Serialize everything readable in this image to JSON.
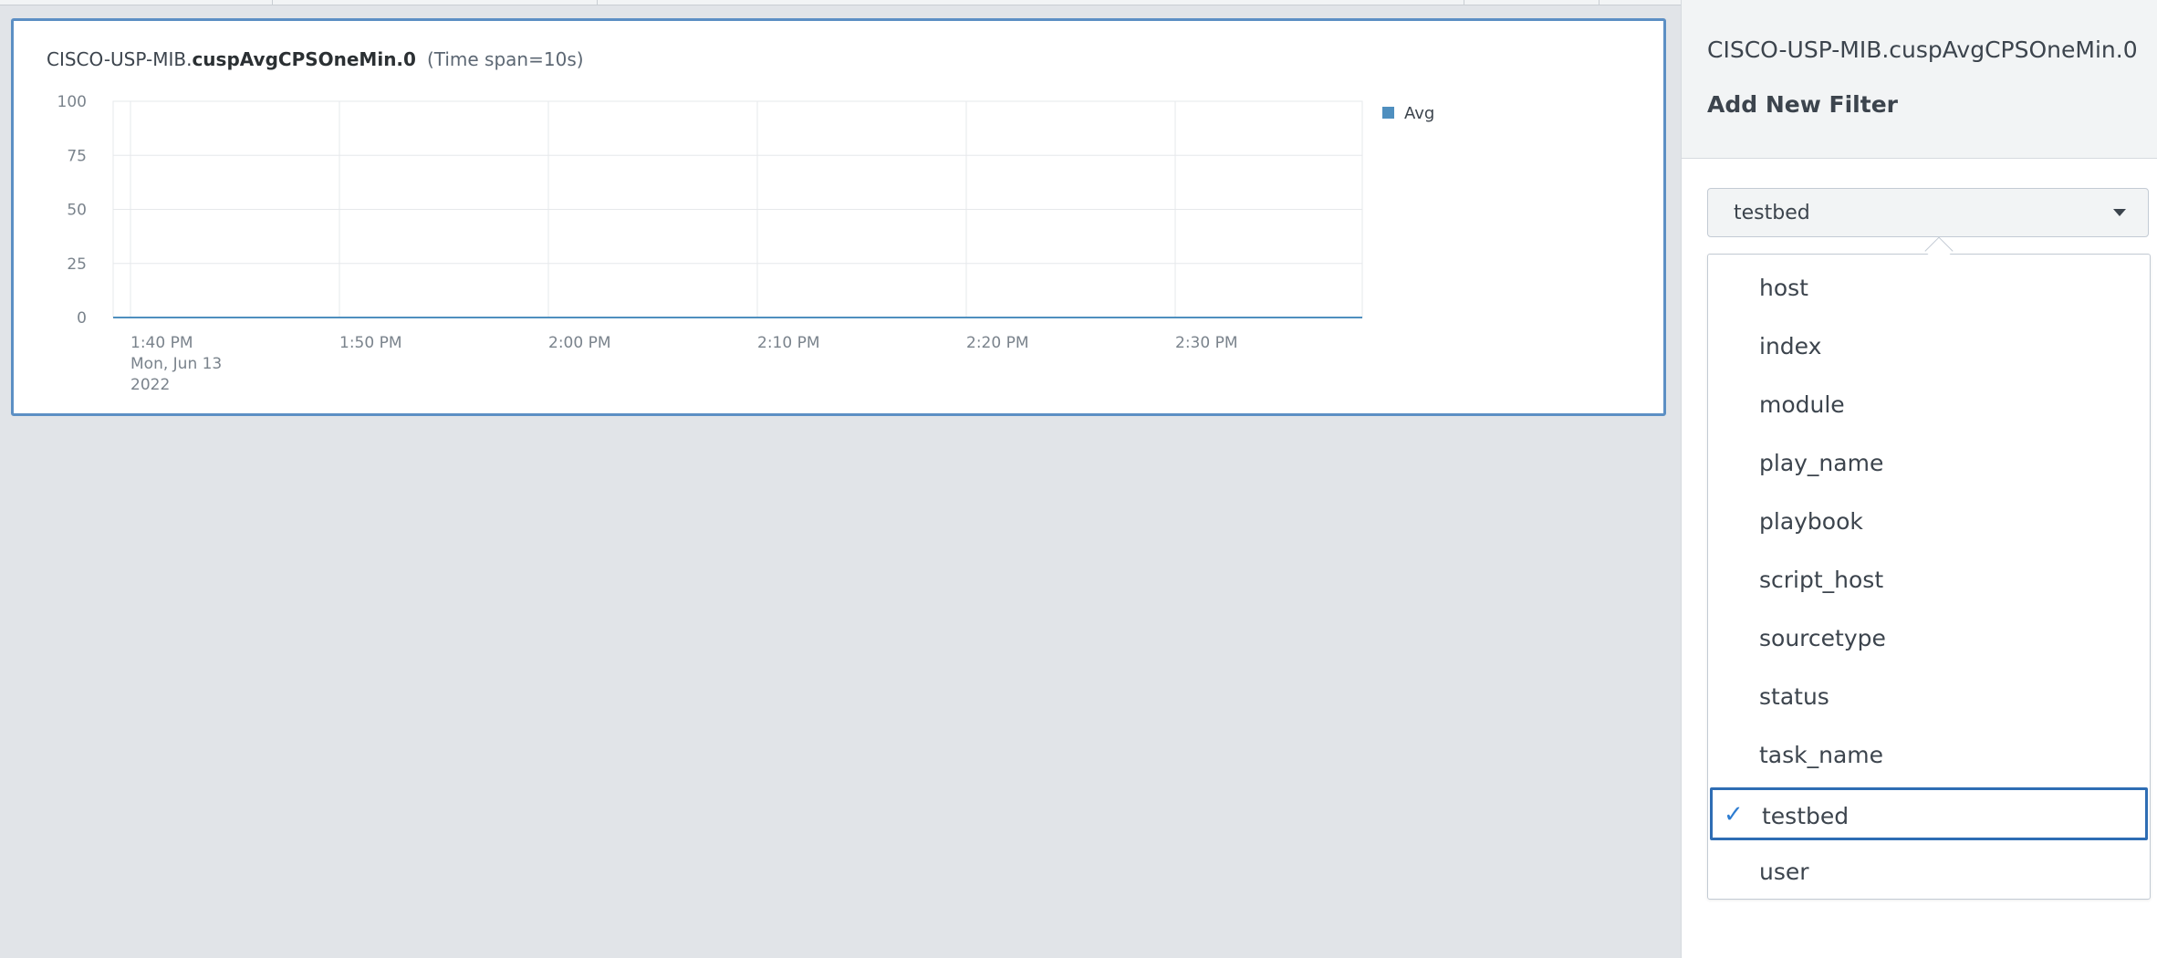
{
  "panel": {
    "metric_prefix": "CISCO-USP-MIB.",
    "metric_name": "cuspAvgCPSOneMin.0",
    "time_span": "(Time span=10s)"
  },
  "chart_data": {
    "type": "line",
    "y_ticks": [
      "100",
      "75",
      "50",
      "25",
      "0"
    ],
    "ylim": [
      0,
      100
    ],
    "x_ticks": [
      "1:40 PM",
      "1:50 PM",
      "2:00 PM",
      "2:10 PM",
      "2:20 PM",
      "2:30 PM"
    ],
    "x_first_sublabel": [
      "Mon, Jun 13",
      "2022"
    ],
    "series": [
      {
        "name": "Avg",
        "color": "#4f8fbf",
        "values": [
          0,
          0,
          0,
          0,
          0,
          0,
          0
        ]
      }
    ],
    "legend_position": "top-right",
    "grid": true
  },
  "side": {
    "metric": "CISCO-USP-MIB.cuspAvgCPSOneMin.0",
    "heading": "Add New Filter",
    "select_value": "testbed",
    "options": [
      {
        "label": "host",
        "selected": false
      },
      {
        "label": "index",
        "selected": false
      },
      {
        "label": "module",
        "selected": false
      },
      {
        "label": "play_name",
        "selected": false
      },
      {
        "label": "playbook",
        "selected": false
      },
      {
        "label": "script_host",
        "selected": false
      },
      {
        "label": "sourcetype",
        "selected": false
      },
      {
        "label": "status",
        "selected": false
      },
      {
        "label": "task_name",
        "selected": false
      },
      {
        "label": "testbed",
        "selected": true
      },
      {
        "label": "user",
        "selected": false
      }
    ],
    "check_glyph": "✓"
  }
}
